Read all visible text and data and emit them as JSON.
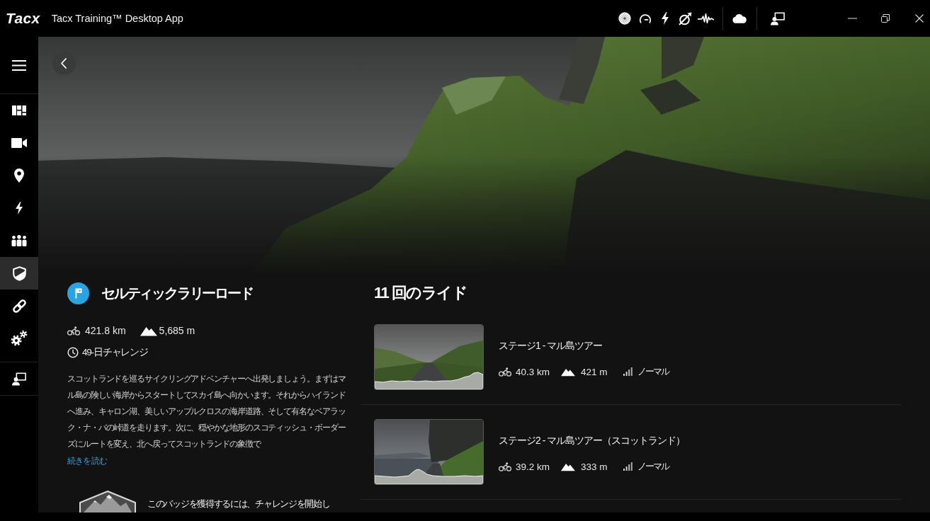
{
  "window": {
    "logo": "Tacx",
    "title": "Tacx Training™ Desktop App"
  },
  "sidebar": {
    "nav_items": [
      {
        "selected": false
      },
      {
        "selected": false
      },
      {
        "selected": false
      },
      {
        "selected": false
      },
      {
        "selected": false
      },
      {
        "selected": true
      },
      {
        "selected": false
      },
      {
        "selected": false
      }
    ],
    "footer_items": [
      {
        "selected": false
      }
    ]
  },
  "challenge": {
    "title": "セルティックラリーロード",
    "distance": "421.8 km",
    "elevation": "5,685 m",
    "duration": "49-日チャレンジ",
    "description": "スコットランドを巡るサイクリングアドベンチャーへ出発しましょう。まずはマル島の険しい海岸からスタートしてスカイ島へ向かいます。それからハイランドへ進み、キャロン湖、美しいアップルクロスの海岸道路、そして有名なベアラック・ナ・バの峠道を走ります。次に、穏やかな地形のスコティッシュ・ボーダーズにルートを変え、北へ戻ってスコットランドの象徴で",
    "read_more": "続きを読む",
    "badge_text": "このバッジを獲得するには、チャレンジを開始し"
  },
  "rides": {
    "heading": "11 回のライド",
    "items": [
      {
        "title": "ステージ1 - マル島ツアー",
        "distance": "40.3 km",
        "elevation": "421 m",
        "difficulty": "ノーマル"
      },
      {
        "title": "ステージ2 - マル島ツアー（スコットランド）",
        "distance": "39.2 km",
        "elevation": "333 m",
        "difficulty": "ノーマル"
      }
    ]
  }
}
